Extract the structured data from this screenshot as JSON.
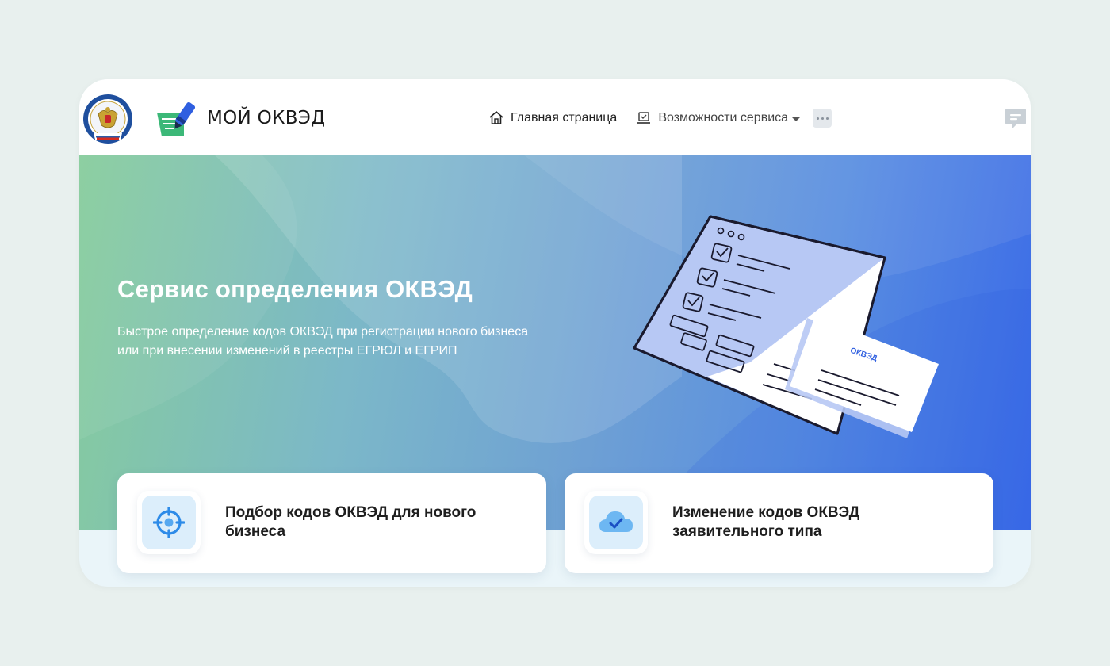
{
  "header": {
    "brand_title": "МОЙ ОКВЭД",
    "nav": [
      {
        "label": "Главная страница",
        "icon": "home-icon"
      },
      {
        "label": "Возможности сервиса",
        "icon": "laptop-check-icon"
      }
    ],
    "more_icon": "more-dots-icon",
    "chat_icon": "chat-icon"
  },
  "hero": {
    "title": "Сервис определения ОКВЭД",
    "subtitle": "Быстрое определение кодов ОКВЭД при регистрации нового бизнеса или при внесении изменений в реестры ЕГРЮЛ и ЕГРИП",
    "illustration_label": "ОКВЭД"
  },
  "cards": [
    {
      "label": "Подбор кодов ОКВЭД для нового бизнеса",
      "icon": "target-icon"
    },
    {
      "label": "Изменение кодов ОКВЭД заявительного типа",
      "icon": "cloud-check-icon"
    }
  ],
  "colors": {
    "hero_start": "#86cc9c",
    "hero_end": "#3a6ae8",
    "brand_green": "#3cb878",
    "brand_blue": "#2f5fe0",
    "icon_blue": "#2d8be8"
  }
}
